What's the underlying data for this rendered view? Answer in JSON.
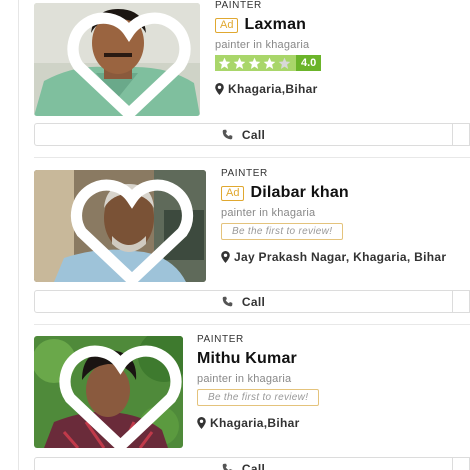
{
  "listings": [
    {
      "category": "PAINTER",
      "ad_label": "Ad",
      "name": "Laxman",
      "subtitle": "painter in khagaria",
      "rating": {
        "value": "4.0",
        "stars_filled": 4,
        "stars_total": 5
      },
      "address": "Khagaria,Bihar",
      "call_label": "Call"
    },
    {
      "category": "PAINTER",
      "ad_label": "Ad",
      "name": "Dilabar khan",
      "subtitle": "painter in khagaria",
      "review_prompt": "Be the first to review!",
      "address": "Jay Prakash Nagar, Khagaria, Bihar",
      "call_label": "Call"
    },
    {
      "category": "PAINTER",
      "name": "Mithu Kumar",
      "subtitle": "painter in khagaria",
      "review_prompt": "Be the first to review!",
      "address": "Khagaria,Bihar",
      "call_label": "Call"
    }
  ],
  "colors": {
    "ad_badge": "#e0a830",
    "rating_green": "#6bb42a",
    "stars_bg": "#a9d66a"
  }
}
